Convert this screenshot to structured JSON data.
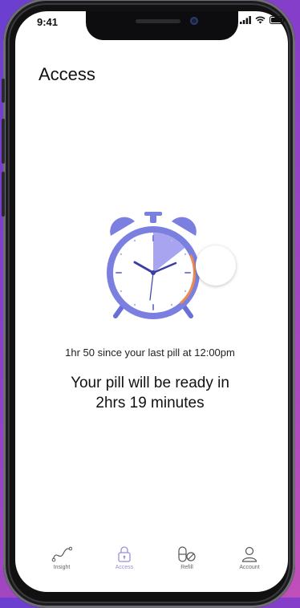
{
  "status_bar": {
    "time": "9:41"
  },
  "header": {
    "title": "Access"
  },
  "timer": {
    "since_text": "1hr 50 since your last pill at 12:00pm",
    "ready_line1": "Your pill will be ready in",
    "ready_line2": "2hrs 19 minutes"
  },
  "colors": {
    "accent": "#7b78e6",
    "clock_body": "#7b7fe0",
    "progress_orange": "#f08a4b"
  },
  "tabbar": {
    "items": [
      {
        "label": "Insight",
        "icon": "insight-icon",
        "active": false
      },
      {
        "label": "Access",
        "icon": "lock-icon",
        "active": true
      },
      {
        "label": "Refill",
        "icon": "pill-refill-icon",
        "active": false
      },
      {
        "label": "Account",
        "icon": "account-icon",
        "active": false
      }
    ]
  }
}
